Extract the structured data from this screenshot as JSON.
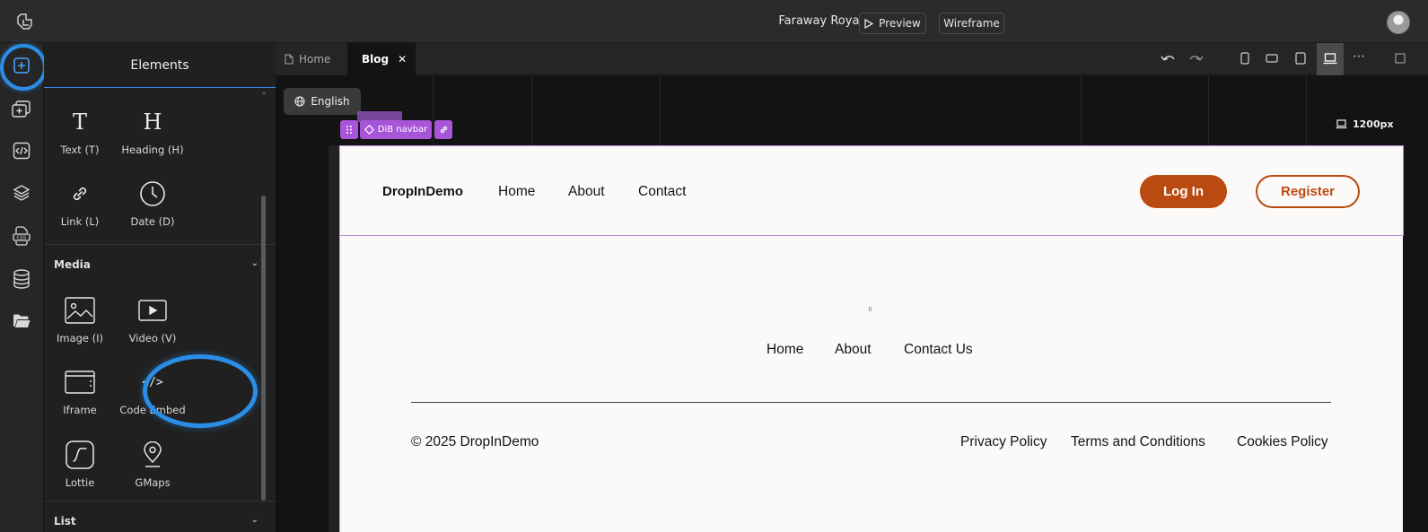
{
  "header": {
    "project_title": "Faraway Royal Ibis",
    "preview_label": "Preview",
    "wireframe_label": "Wireframe"
  },
  "rail": {
    "icons": [
      "add-element-icon",
      "add-section-icon",
      "code-icon",
      "layers-icon",
      "css-icon",
      "database-icon",
      "folder-icon"
    ]
  },
  "panel": {
    "title": "Elements",
    "basic_items": [
      {
        "label": "Text (T)",
        "icon": "text-icon"
      },
      {
        "label": "Heading (H)",
        "icon": "heading-icon"
      },
      {
        "label": "Link (L)",
        "icon": "link-icon"
      },
      {
        "label": "Date (D)",
        "icon": "clock-icon"
      }
    ],
    "media_section": "Media",
    "media_items": [
      {
        "label": "Image (I)",
        "icon": "image-icon"
      },
      {
        "label": "Video (V)",
        "icon": "video-icon"
      },
      {
        "label": "Iframe",
        "icon": "iframe-icon"
      },
      {
        "label": "Code Embed",
        "icon": "code-embed-icon"
      },
      {
        "label": "Lottie",
        "icon": "lottie-icon"
      },
      {
        "label": "GMaps",
        "icon": "map-pin-icon"
      }
    ],
    "list_section": "List"
  },
  "tabs": [
    {
      "label": "Home",
      "active": false
    },
    {
      "label": "Blog",
      "active": true
    }
  ],
  "canvas": {
    "language": "English",
    "width_label": "1200px",
    "selection_label": "DiB navbar"
  },
  "page": {
    "brand": "DropInDemo",
    "nav_links": [
      "Home",
      "About",
      "Contact"
    ],
    "login_label": "Log In",
    "register_label": "Register",
    "accent_color": "#bb4a10",
    "footer_links": [
      "Home",
      "About",
      "Contact Us"
    ],
    "copyright": "© 2025 DropInDemo",
    "legal_links": [
      "Privacy Policy",
      "Terms and Conditions",
      "Cookies Policy"
    ]
  }
}
